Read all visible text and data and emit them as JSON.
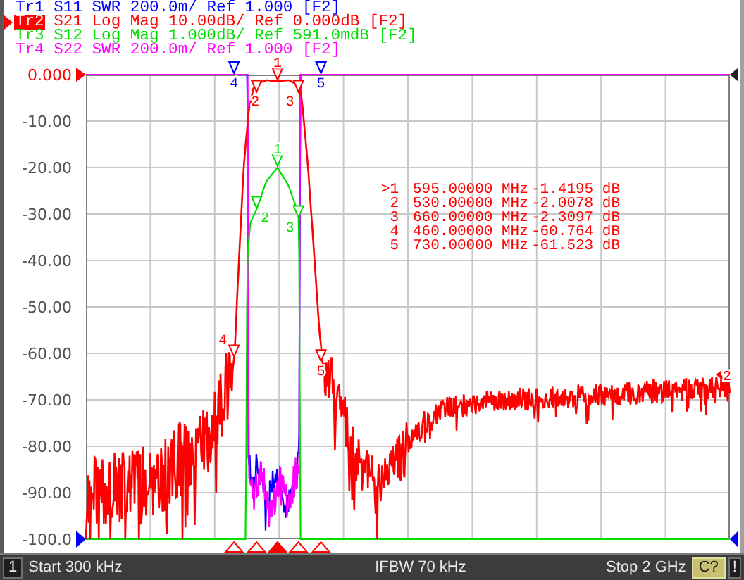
{
  "traces": [
    {
      "label": "Tr1",
      "parameter": "S11",
      "format": "SWR",
      "scale": "200.0m/",
      "reference": "Ref 1.000",
      "channel": "[F2]",
      "color": "#0000ff",
      "active": false,
      "markers": [
        "4",
        "5"
      ]
    },
    {
      "label": "Tr2",
      "parameter": "S21",
      "format": "Log Mag",
      "scale": "10.00dB/",
      "reference": "Ref 0.000dB",
      "channel": "[F2]",
      "color": "#ff0000",
      "active": true,
      "markers": [
        "1",
        "2",
        "3",
        "4",
        "5"
      ]
    },
    {
      "label": "Tr3",
      "parameter": "S12",
      "format": "Log Mag",
      "scale": "1.000dB/",
      "reference": "Ref 591.0mdB",
      "channel": "[F2]",
      "color": "#00e000",
      "active": false,
      "markers": [
        "1",
        "2",
        "3"
      ]
    },
    {
      "label": "Tr4",
      "parameter": "S22",
      "format": "SWR",
      "scale": "200.0m/",
      "reference": "Ref 1.000",
      "channel": "[F2]",
      "color": "#ff00ff",
      "active": false
    }
  ],
  "plot": {
    "y_labels": [
      "0.000",
      "-10.00",
      "-20.00",
      "-30.00",
      "-40.00",
      "-50.00",
      "-60.00",
      "-70.00",
      "-80.00",
      "-90.00",
      "-100.0"
    ],
    "end_marker": "2"
  },
  "marker_readout": [
    {
      "label": ">1",
      "frequency": "595.00000 MHz",
      "value": "-1.4195 dB",
      "active": true
    },
    {
      "label": "2",
      "frequency": "530.00000 MHz",
      "value": "-2.0078 dB",
      "active": false
    },
    {
      "label": "3",
      "frequency": "660.00000 MHz",
      "value": "-2.3097 dB",
      "active": false
    },
    {
      "label": "4",
      "frequency": "460.00000 MHz",
      "value": "-60.764 dB",
      "active": false
    },
    {
      "label": "5",
      "frequency": "730.00000 MHz",
      "value": "-61.523 dB",
      "active": false
    }
  ],
  "status_bar": {
    "channel": "1",
    "start": "Start 300 kHz",
    "ifbw": "IFBW 70 kHz",
    "stop": "Stop 2 GHz",
    "calibration": "C?",
    "alert": "!"
  }
}
